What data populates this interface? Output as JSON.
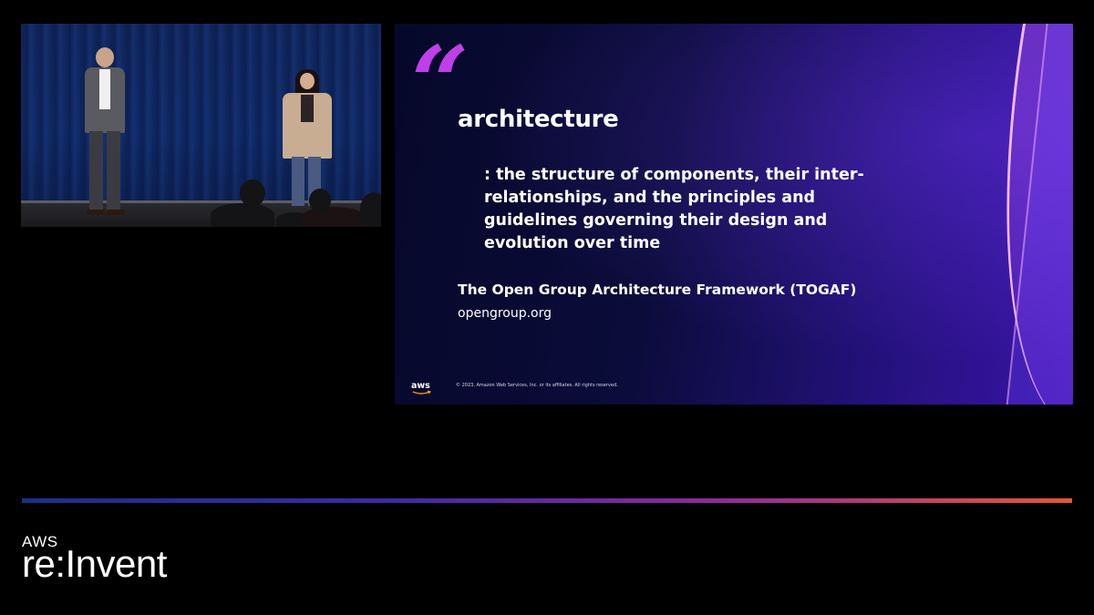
{
  "video_feed": {
    "label": ""
  },
  "slide": {
    "quote_mark": "“",
    "term": "architecture",
    "definition": ": the structure of components, their inter-relationships, and the principles and guidelines governing their design and evolution over time",
    "source": "The Open Group Architecture Framework (TOGAF)",
    "source_url": "opengroup.org",
    "logo_text": "aws",
    "copyright": "© 2023, Amazon Web Services, Inc. or its affiliates. All rights reserved."
  },
  "brand": {
    "aws": "AWS",
    "event": "re:Invent"
  },
  "colors": {
    "quote_accent": "#c040e8",
    "rule_start": "#1b2f8a",
    "rule_end": "#e5553a",
    "slide_bg_dark": "#06082a",
    "slide_bg_purple": "#3a14a8"
  }
}
